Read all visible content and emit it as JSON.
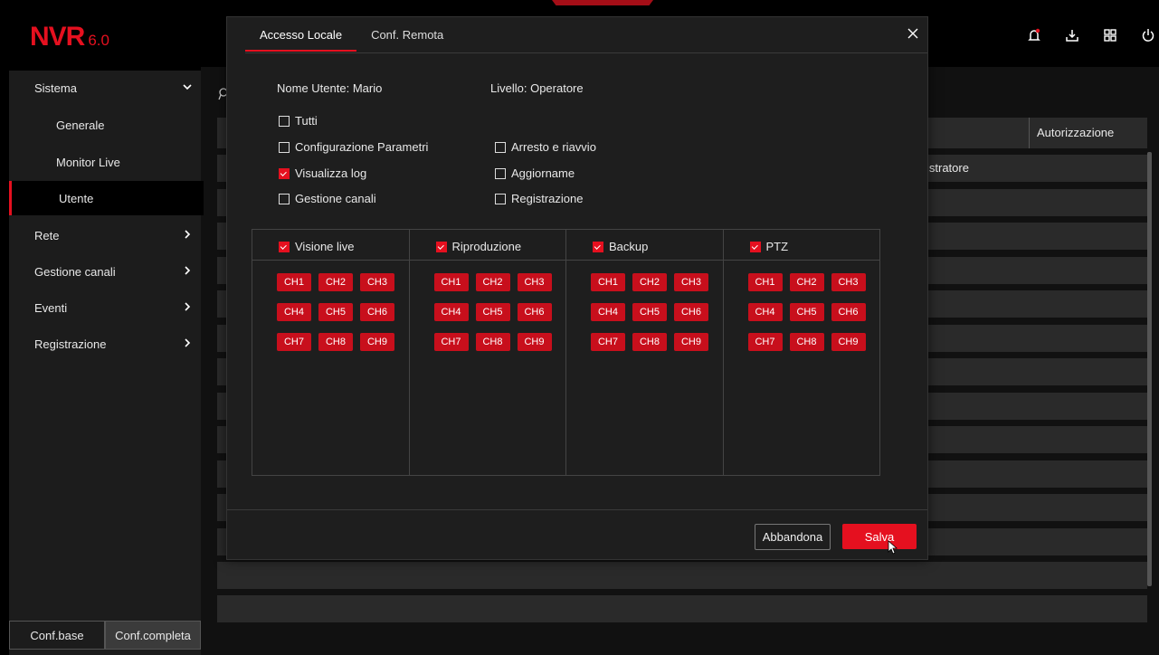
{
  "app": {
    "logo": "NVR",
    "version": "6.0"
  },
  "top_icons": [
    "bell-icon",
    "download-icon",
    "grid-icon",
    "power-icon"
  ],
  "sidebar": {
    "items": [
      {
        "label": "Sistema"
      },
      {
        "label": "Generale"
      },
      {
        "label": "Monitor Live"
      },
      {
        "label": "Utente"
      },
      {
        "label": "Rete"
      },
      {
        "label": "Gestione canali"
      },
      {
        "label": "Eventi"
      },
      {
        "label": "Registrazione"
      }
    ],
    "footer": {
      "basic": "Conf.base",
      "full": "Conf.completa"
    }
  },
  "background": {
    "column_header": "Autorizzazione",
    "row1_cell": "istratore"
  },
  "dialog": {
    "tabs": [
      "Accesso Locale",
      "Conf. Remota"
    ],
    "user_label": "Nome Utente: Mario",
    "level_label": "Livello: Operatore",
    "permissions": {
      "all": {
        "label": "Tutti",
        "checked": false
      },
      "config": {
        "label": "Configurazione Parametri",
        "checked": false
      },
      "shutdown": {
        "label": "Arresto e riavvio",
        "checked": false
      },
      "log": {
        "label": "Visualizza log",
        "checked": true
      },
      "update": {
        "label": "Aggiorname",
        "checked": false
      },
      "channels": {
        "label": "Gestione canali",
        "checked": false
      },
      "record": {
        "label": "Registrazione",
        "checked": false
      }
    },
    "columns": [
      {
        "label": "Visione live",
        "checked": true
      },
      {
        "label": "Riproduzione",
        "checked": true
      },
      {
        "label": "Backup",
        "checked": true
      },
      {
        "label": "PTZ",
        "checked": true
      }
    ],
    "channels": [
      "CH1",
      "CH2",
      "CH3",
      "CH4",
      "CH5",
      "CH6",
      "CH7",
      "CH8",
      "CH9"
    ],
    "buttons": {
      "cancel": "Abbandona",
      "save": "Salva"
    }
  },
  "colors": {
    "accent": "#e5101f",
    "background": "#000000",
    "panel": "#1e1e1e"
  }
}
